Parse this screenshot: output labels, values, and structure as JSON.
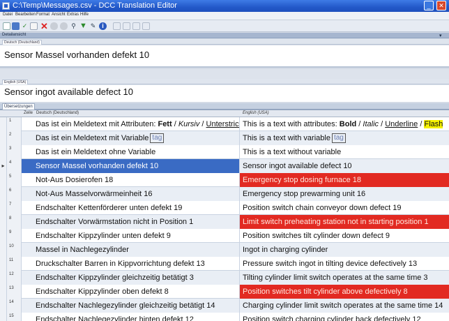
{
  "window": {
    "title": "C:\\Temp\\Messages.csv - DCC Translation Editor",
    "minimize_glyph": "_",
    "close_glyph": "✕"
  },
  "menu": [
    "Datei",
    "Bearbeiten",
    "Format",
    "Ansicht",
    "Extras",
    "Hilfe"
  ],
  "toolbar_icons": [
    "new-icon",
    "save-icon",
    "check-icon",
    "copy-icon",
    "delete-icon",
    "print-icon",
    "print-preview-icon",
    "search-icon",
    "filter-icon",
    "edit-icon",
    "help-icon",
    "tool-1-icon",
    "tool-2-icon",
    "tool-3-icon",
    "tool-4-icon"
  ],
  "detail": {
    "header": "Detailansicht",
    "source_tab": "Deutsch (Deutschland)",
    "source_text": "Sensor Massel vorhanden defekt 10",
    "target_tab": "English (USA)",
    "target_text": "Sensor ingot available defect 10",
    "pin": "▾"
  },
  "translations": {
    "tab": "Übersetzungen",
    "columns": {
      "id": "Zeile",
      "source": "Deutsch (Deutschland)",
      "target": "English (USA)"
    },
    "rows": [
      {
        "id": "1",
        "de": "Das ist ein Meldetext mit Attributen: Fett / Kursiv / Unterstrichen",
        "en": "This is a text with attributes: Bold / Italic / Underline / Flash",
        "status": "normal"
      },
      {
        "id": "2",
        "de": "Das ist ein Meldetext mit Variable",
        "de_var": "tag",
        "en": "This is a text with variable",
        "en_var": "tag",
        "status": "normal"
      },
      {
        "id": "3",
        "de": "Das ist ein Meldetext ohne Variable",
        "en": "This is a text without variable",
        "status": "normal"
      },
      {
        "id": "4",
        "de": "Sensor Massel vorhanden defekt 10",
        "en": "Sensor ingot available defect 10",
        "status": "selected"
      },
      {
        "id": "5",
        "de": "Not-Aus Dosierofen 18",
        "en": "Emergency stop dosing furnace 18",
        "status": "error"
      },
      {
        "id": "6",
        "de": "Not-Aus Masselvorwärmeinheit 16",
        "en": "Emergency stop prewarming unit 16",
        "status": "normal"
      },
      {
        "id": "7",
        "de": "Endschalter Kettenförderer unten defekt 19",
        "en": "Position switch chain conveyor down defect 19",
        "status": "normal"
      },
      {
        "id": "8",
        "de": "Endschalter Vorwärmstation nicht in Position 1",
        "en": "Limit switch preheating station not in starting position 1",
        "status": "error"
      },
      {
        "id": "9",
        "de": "Endschalter Kippzylinder unten defekt 9",
        "en": "Position switches tilt cylinder down defect 9",
        "status": "normal"
      },
      {
        "id": "10",
        "de": "Massel in Nachlegezylinder",
        "en": "Ingot in charging cylinder",
        "status": "normal"
      },
      {
        "id": "11",
        "de": "Druckschalter Barren in Kippvorrichtung defekt 13",
        "en": "Pressure switch ingot in tilting device defectively 13",
        "status": "normal"
      },
      {
        "id": "12",
        "de": "Endschalter Kippzylinder gleichzeitig betätigt 3",
        "en": "Tilting cylinder limit switch operates at the same time 3",
        "status": "normal"
      },
      {
        "id": "13",
        "de": "Endschalter Kippzylinder oben defekt 8",
        "en": "Position switches tilt cylinder above defectively 8",
        "status": "error"
      },
      {
        "id": "14",
        "de": "Endschalter Nachlegezylinder gleichzeitig betätigt 14",
        "en": "Charging cylinder limit switch operates at the same time 14",
        "status": "normal"
      },
      {
        "id": "15",
        "de": "Endschalter Nachlegezylinder hinten defekt 12",
        "en": "Position switch charging cylinder back defectively 12",
        "status": "normal"
      }
    ]
  },
  "colors": {
    "error": "#e22a22",
    "selected": "#3a6bc4",
    "flash": "#f4f000"
  },
  "row_pointer": "▸"
}
